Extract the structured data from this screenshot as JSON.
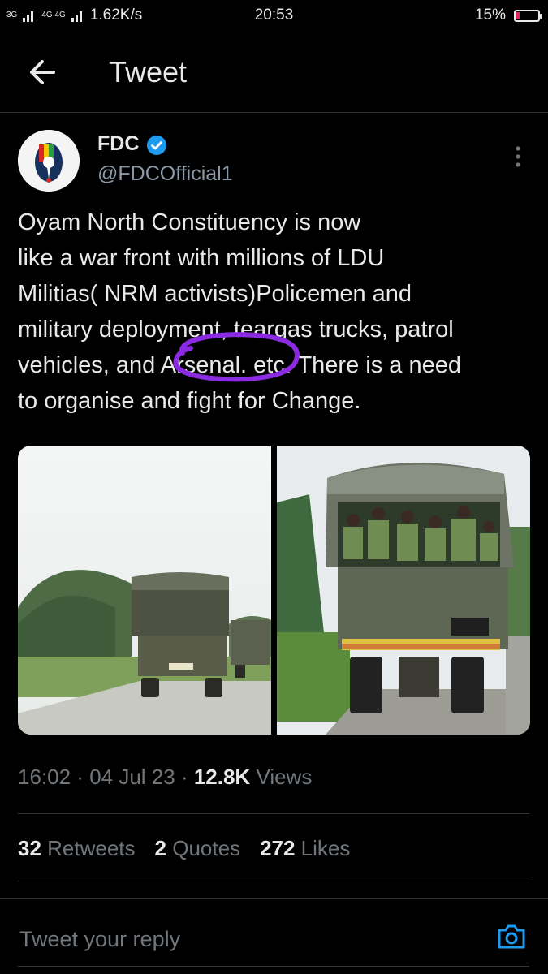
{
  "status_bar": {
    "net_left": "3G",
    "net_right": "4G 4G",
    "speed": "1.62K/s",
    "time": "20:53",
    "battery": "15%",
    "battery_level": 0.15,
    "battery_color": "#e0245e"
  },
  "header": {
    "title": "Tweet",
    "back_icon": "arrow-left-icon"
  },
  "author": {
    "name": "FDC",
    "handle": "@FDCOfficial1",
    "verified_color": "#1d9bf0"
  },
  "tweet": {
    "text": "Oyam North Constituency is now\nlike a war front with millions of LDU\nMilitias( NRM activists)Policemen and\nmilitary deployment, teargas trucks, patrol\nvehicles, and Arsenal. etc. There is a need\nto organise and fight for Change.",
    "annotation_color": "#8a2be2"
  },
  "meta": {
    "time": "16:02",
    "sep1": " · ",
    "date": "04 Jul 23",
    "sep2": " · ",
    "views_count": "12.8K",
    "views_label": " Views"
  },
  "stats": {
    "retweets_count": "32",
    "retweets_label": " Retweets",
    "quotes_count": "2",
    "quotes_label": " Quotes",
    "likes_count": "272",
    "likes_label": " Likes"
  },
  "reply": {
    "placeholder": "Tweet your reply",
    "camera_icon": "camera-icon",
    "accent": "#1d9bf0"
  }
}
